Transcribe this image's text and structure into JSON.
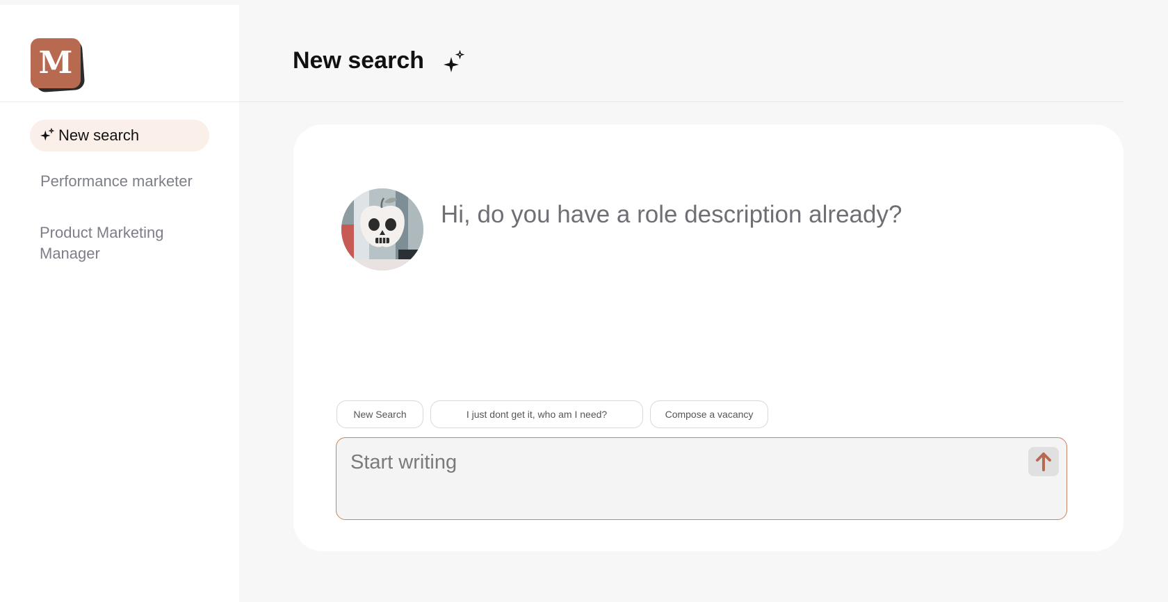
{
  "sidebar": {
    "logo_letter": "M",
    "new_search_label": "New search",
    "items": [
      {
        "label": "Performance marketer"
      },
      {
        "label": "Product Marketing Manager"
      }
    ]
  },
  "header": {
    "title": "New search"
  },
  "chat": {
    "message": "Hi, do you have a role description already?",
    "suggestions": [
      {
        "label": "New Search"
      },
      {
        "label": "I just dont get it, who am I need?"
      },
      {
        "label": "Compose a vacancy"
      }
    ],
    "composer": {
      "placeholder": "Start writing",
      "value": ""
    }
  },
  "colors": {
    "accent": "#b86a50",
    "composer_border": "#c98466",
    "active_nav_bg": "#fbefe9"
  },
  "icons": {
    "logo": "monogram-logo",
    "sparkle": "sparkle-icon",
    "send": "arrow-up-icon",
    "avatar": "skull-apple-avatar"
  }
}
